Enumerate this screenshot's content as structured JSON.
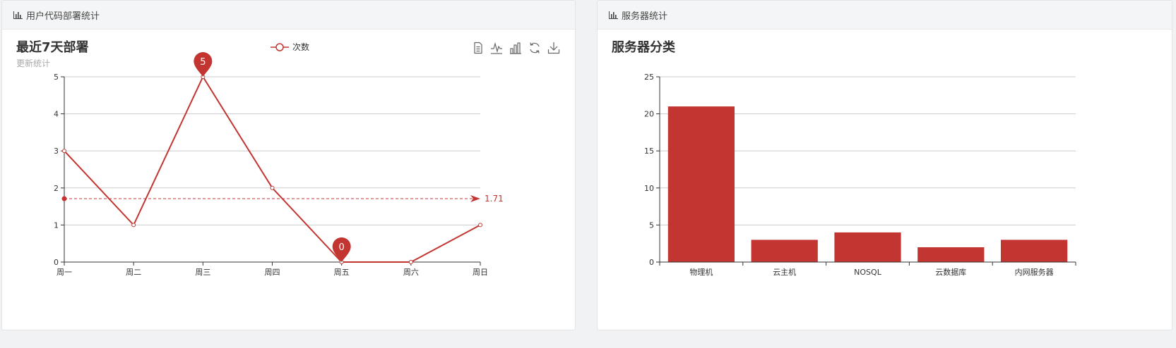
{
  "left_panel": {
    "header_title": "用户代码部署统计",
    "header_icon": "bar-chart-icon",
    "toolbox": [
      "data-view-icon",
      "line-chart-icon",
      "bar-chart-icon",
      "restore-icon",
      "download-icon"
    ]
  },
  "right_panel": {
    "header_title": "服务器统计",
    "header_icon": "bar-chart-icon"
  },
  "colors": {
    "series": "#c23531",
    "grid": "#cccccc",
    "axis": "#333333"
  },
  "chart_data": [
    {
      "type": "line",
      "title": "最近7天部署",
      "subtitle": "更新统计",
      "categories": [
        "周一",
        "周二",
        "周三",
        "周四",
        "周五",
        "周六",
        "周日"
      ],
      "series": [
        {
          "name": "次数",
          "values": [
            3,
            1,
            5,
            2,
            0,
            0,
            1
          ]
        }
      ],
      "ylim": [
        0,
        5
      ],
      "yticks": [
        "0",
        "1",
        "2",
        "3",
        "4",
        "5"
      ],
      "mark_points": [
        {
          "label": "5",
          "category": "周三",
          "value": 5
        },
        {
          "label": "0",
          "category": "周五",
          "value": 0
        }
      ],
      "mark_line": {
        "label": "1.71",
        "value": 1.71
      },
      "legend": "top-center",
      "grid": true
    },
    {
      "type": "bar",
      "title": "服务器分类",
      "categories": [
        "物理机",
        "云主机",
        "NOSQL",
        "云数据库",
        "内网服务器"
      ],
      "values": [
        21,
        3,
        4,
        2,
        3
      ],
      "ylim": [
        0,
        25
      ],
      "yticks": [
        "0",
        "5",
        "10",
        "15",
        "20",
        "25"
      ],
      "grid": true
    }
  ]
}
